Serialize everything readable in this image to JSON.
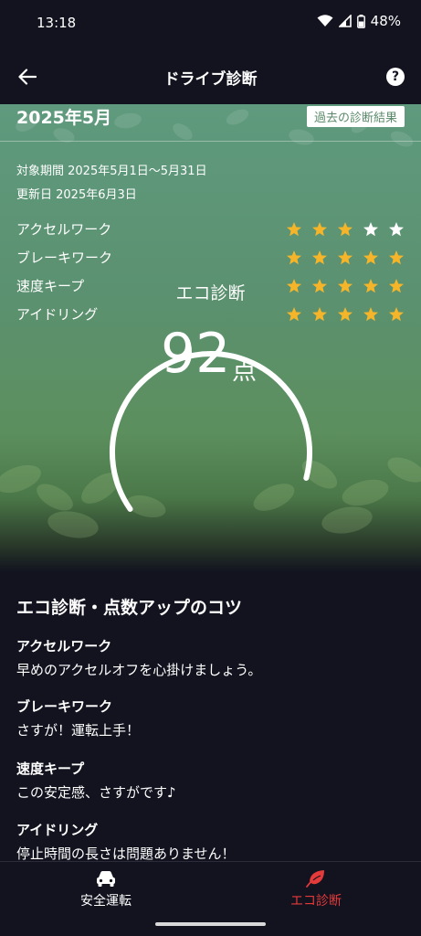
{
  "status": {
    "time": "13:18",
    "battery": "48%"
  },
  "app_bar": {
    "title": "ドライブ診断",
    "help": "?"
  },
  "hero": {
    "period_title": "2025年5月",
    "past_results_link": "過去の診断結果",
    "target_period": "対象期間 2025年5月1日〜5月31日",
    "updated": "更新日 2025年6月3日",
    "ratings": [
      {
        "label": "アクセルワーク",
        "stars": 3,
        "max": 5
      },
      {
        "label": "ブレーキワーク",
        "stars": 5,
        "max": 5
      },
      {
        "label": "速度キープ",
        "stars": 5,
        "max": 5
      },
      {
        "label": "アイドリング",
        "stars": 5,
        "max": 5
      }
    ],
    "gauge": {
      "label": "エコ診断",
      "score": "92",
      "unit": "点",
      "value": 92,
      "max": 100
    }
  },
  "tips": {
    "title": "エコ診断・点数アップのコツ",
    "items": [
      {
        "head": "アクセルワーク",
        "body": "早めのアクセルオフを心掛けましょう。"
      },
      {
        "head": "ブレーキワーク",
        "body": "さすが！運転上手！"
      },
      {
        "head": "速度キープ",
        "body": "この安定感、さすがです♪"
      },
      {
        "head": "アイドリング",
        "body": "停止時間の長さは問題ありません！"
      }
    ]
  },
  "bottom_nav": {
    "items": [
      {
        "label": "安全運転",
        "icon": "car-icon",
        "active": false
      },
      {
        "label": "エコ診断",
        "icon": "leaf-icon",
        "active": true
      }
    ]
  },
  "colors": {
    "star_filled": "#f4b52a",
    "star_empty": "#ffffff",
    "active_nav": "#e43a3a",
    "background": "#12131f"
  }
}
